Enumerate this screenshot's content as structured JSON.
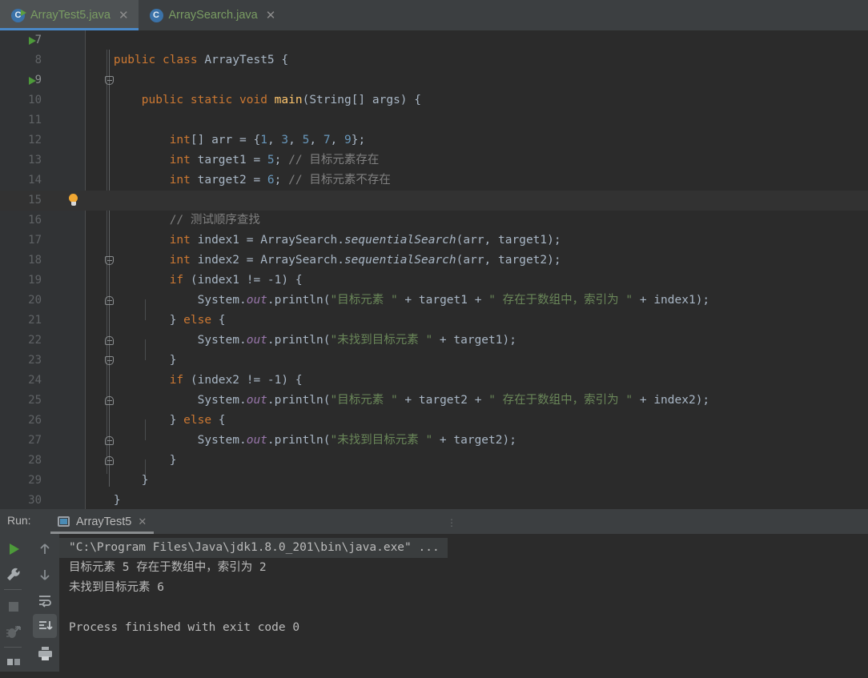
{
  "window": {
    "theme_bg": "#2b2b2b",
    "panel_bg": "#3c3f41",
    "accent": "#4a88c7"
  },
  "tabs": [
    {
      "label": "ArrayTest5.java",
      "icon": "java-class-runnable-icon",
      "close": "✕",
      "letter": "C",
      "active": true
    },
    {
      "label": "ArraySearch.java",
      "icon": "java-class-icon",
      "close": "✕",
      "letter": "C",
      "active": false
    }
  ],
  "editor": {
    "lines": [
      {
        "no": "7",
        "run": true
      },
      {
        "no": "8",
        "run": false
      },
      {
        "no": "9",
        "run": true
      },
      {
        "no": "10",
        "run": false
      },
      {
        "no": "11",
        "run": false
      },
      {
        "no": "12",
        "run": false
      },
      {
        "no": "13",
        "run": false
      },
      {
        "no": "14",
        "run": false
      },
      {
        "no": "15",
        "run": false,
        "bulb": true
      },
      {
        "no": "16",
        "run": false
      },
      {
        "no": "17",
        "run": false
      },
      {
        "no": "18",
        "run": false
      },
      {
        "no": "19",
        "run": false
      },
      {
        "no": "20",
        "run": false
      },
      {
        "no": "21",
        "run": false
      },
      {
        "no": "22",
        "run": false
      },
      {
        "no": "23",
        "run": false
      },
      {
        "no": "24",
        "run": false
      },
      {
        "no": "25",
        "run": false
      },
      {
        "no": "26",
        "run": false
      },
      {
        "no": "27",
        "run": false
      },
      {
        "no": "28",
        "run": false
      },
      {
        "no": "29",
        "run": false
      },
      {
        "no": "30",
        "run": false
      }
    ],
    "code": {
      "l7_kw_public": "public",
      "l7_kw_class": "class",
      "l7_name": "ArrayTest5",
      "l7_brace": "{",
      "l9_public": "public",
      "l9_static": "static",
      "l9_void": "void",
      "l9_main": "main",
      "l9_params": "(String[] args) {",
      "l11_int": "int",
      "l11_a": "[] arr = {",
      "l11_n1": "1",
      "l11_c1": ", ",
      "l11_n2": "3",
      "l11_c2": ", ",
      "l11_n3": "5",
      "l11_c3": ", ",
      "l11_n4": "7",
      "l11_c4": ", ",
      "l11_n5": "9",
      "l11_end": "};",
      "l12_int": "int",
      "l12_name": " target1 = ",
      "l12_num": "5",
      "l12_semi": ";",
      "l12_cmt": "// 目标元素存在",
      "l13_int": "int",
      "l13_name": " target2 = ",
      "l13_num": "6",
      "l13_semi": ";",
      "l13_cmt": "// 目标元素不存在",
      "l15_cmt": "// 测试顺序查找",
      "l16_int": "int",
      "l16_pre": " index1 = ArraySearch.",
      "l16_mth": "sequentialSearch",
      "l16_post": "(arr, target1);",
      "l17_int": "int",
      "l17_pre": " index2 = ArraySearch.",
      "l17_mth": "sequentialSearch",
      "l17_post": "(arr, target2);",
      "l18_if": "if",
      "l18_rest": " (index1 != -1) {",
      "l19_sys": "System.",
      "l19_out": "out",
      "l19_println": ".println(",
      "l19_s1": "\"目标元素 \"",
      "l19_plus1": " + target1 + ",
      "l19_s2": "\" 存在于数组中，索引为 \"",
      "l19_plus2": " + index1);",
      "l20_close": "} ",
      "l20_else": "else",
      "l20_open": " {",
      "l21_sys": "System.",
      "l21_out": "out",
      "l21_println": ".println(",
      "l21_s1": "\"未找到目标元素 \"",
      "l21_tail": " + target1);",
      "l22_brace": "}",
      "l23_if": "if",
      "l23_rest": " (index2 != -1) {",
      "l24_s2": "\" 存在于数组中，索引为 \"",
      "l24_plus1": " + target2 + ",
      "l24_plus2": " + index2);",
      "l25_close": "} ",
      "l25_else": "else",
      "l25_open": " {",
      "l26_tail": " + target2);",
      "l27_brace": "}",
      "l28_brace": "}",
      "l29_brace": "}"
    }
  },
  "run_panel": {
    "run_label": "Run:",
    "tab_label": "ArrayTest5",
    "tab_close": "✕",
    "overflow_dots": "⋮",
    "toolbar_left": [
      {
        "name": "rerun-button",
        "icon": "play-icon"
      },
      {
        "name": "settings-button",
        "icon": "wrench-icon"
      },
      {
        "name": "stop-button",
        "icon": "stop-square-icon"
      },
      {
        "name": "rerun-failed-tests-button",
        "icon": "bug-icon"
      },
      {
        "name": "layout-button",
        "icon": "layout-icon"
      }
    ],
    "toolbar_right": [
      {
        "name": "scroll-up-button",
        "icon": "arrow-up-icon"
      },
      {
        "name": "scroll-down-button",
        "icon": "arrow-down-icon"
      },
      {
        "name": "soft-wrap-button",
        "icon": "soft-wrap-icon"
      },
      {
        "name": "scroll-to-end-button",
        "icon": "scroll-to-end-icon"
      },
      {
        "name": "print-button",
        "icon": "printer-icon"
      }
    ],
    "console_lines": [
      {
        "text": "\"C:\\Program Files\\Java\\jdk1.8.0_201\\bin\\java.exe\" ...",
        "selected": true
      },
      {
        "text": "目标元素 5 存在于数组中，索引为 2",
        "selected": false
      },
      {
        "text": "未找到目标元素 6",
        "selected": false
      },
      {
        "text": "",
        "selected": false
      },
      {
        "text": "Process finished with exit code 0",
        "selected": false
      }
    ]
  }
}
